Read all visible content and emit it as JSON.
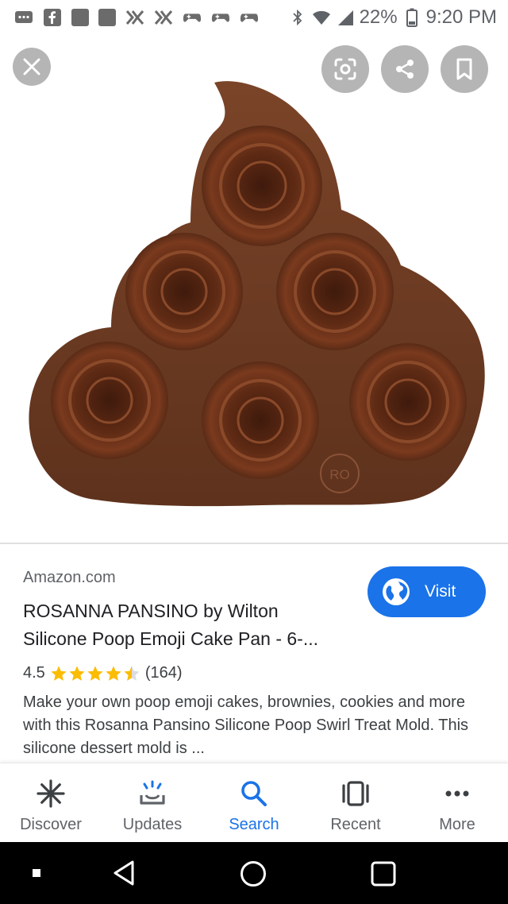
{
  "status_bar": {
    "battery": "22%",
    "time": "9:20 PM"
  },
  "image": {
    "alt": "ROSANNA PANSINO by Wilton Silicone Poop Emoji Cake Pan",
    "logo_text": "RO"
  },
  "result": {
    "source": "Amazon.com",
    "title_line1": "ROSANNA PANSINO by Wilton",
    "title_line2": "Silicone Poop Emoji Cake Pan - 6-...",
    "visit_label": "Visit",
    "rating": "4.5",
    "rating_value": 4.5,
    "review_count": "(164)",
    "description": "Make your own poop emoji cakes, brownies, cookies and more with this Rosanna Pansino Silicone Poop Swirl Treat Mold. This silicone dessert mold is ..."
  },
  "bottom_nav": {
    "items": [
      {
        "label": "Discover",
        "icon": "asterisk-icon"
      },
      {
        "label": "Updates",
        "icon": "updates-icon"
      },
      {
        "label": "Search",
        "icon": "search-icon",
        "active": true
      },
      {
        "label": "Recent",
        "icon": "recent-tabs-icon"
      },
      {
        "label": "More",
        "icon": "more-dots-icon"
      }
    ]
  },
  "colors": {
    "accent": "#1a73e8",
    "star": "#fbbc04",
    "mold_brown": "#6b3a22"
  }
}
